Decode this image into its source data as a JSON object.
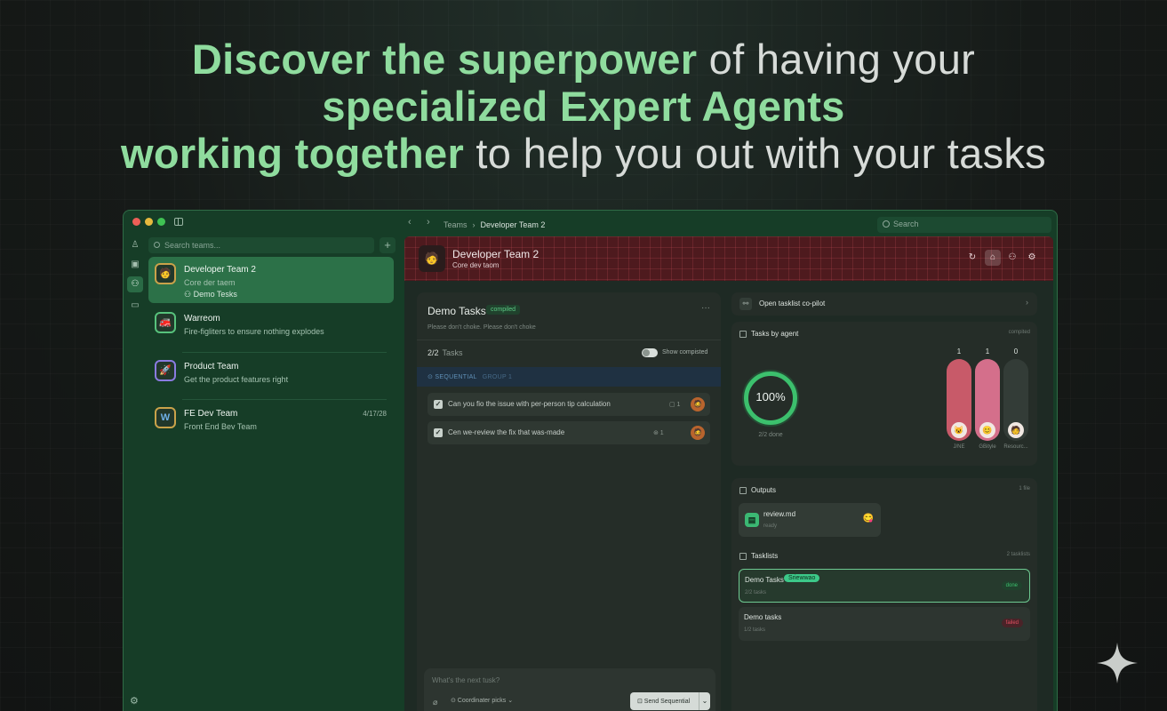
{
  "headline": {
    "line1_highlight": "Discover the superpower",
    "line1_rest": " of having your",
    "line2_highlight": "specialized Expert Agents",
    "line3_highlight": "working together",
    "line3_rest": " to help you out with your tasks"
  },
  "window": {
    "breadcrumb": {
      "root": "Teams",
      "current": "Developer Team 2"
    },
    "search_placeholder": "Search"
  },
  "sidebar": {
    "search_placeholder": "Search teams...",
    "add_label": "+",
    "teams": [
      {
        "name": "Developer Team 2",
        "desc": "Core der taem",
        "sub": "Demo Tesks",
        "date": "",
        "avatar": "🧑",
        "color": "#c9a24a"
      },
      {
        "name": "Warreom",
        "desc": "Fire-figliters to ensure nothing explodes",
        "sub": "",
        "date": "",
        "avatar": "🚒",
        "color": "#57c27c"
      },
      {
        "name": "Product Team",
        "desc": "Get the product features right",
        "sub": "",
        "date": "",
        "avatar": "🚀",
        "color": "#8a7be0"
      },
      {
        "name": "FE Dev Team",
        "desc": "Front End Bev Team",
        "sub": "",
        "date": "4/17/28",
        "avatar": "W",
        "color": "#c9a24a"
      }
    ]
  },
  "banner": {
    "title": "Developer Team 2",
    "subtitle": "Core dev taom",
    "avatar": "🧑"
  },
  "tasks": {
    "title": "Demo Tasks",
    "status": "compiled",
    "description": "Please don't choke. Please don't choke",
    "count": "2/2",
    "count_label": "Tasks",
    "toggle_label": "Show compisted",
    "group_label": "⊙ SEQUENTIAL",
    "group_sub": "GROUP 1",
    "items": [
      {
        "text": "Can you fio the issue with per-person tip calculation",
        "meta": "▢ 1",
        "avatar": "🧔"
      },
      {
        "text": "Cen we-review the fix that was-made",
        "meta": "⊛ 1",
        "avatar": "🧔"
      }
    ],
    "composer_placeholder": "What's the next tusk?",
    "coordinator_label": "⊙ Coordinater picks ⌄",
    "send_label": "⊡ Send Sequential",
    "send_chevron": "⌄"
  },
  "copilot": {
    "label": "Open tasklist co-pilot",
    "icon": "link-icon"
  },
  "agents_card": {
    "title": "Tasks by agent",
    "right_label": "compited",
    "ring_value": "100%",
    "ring_sub": "2/2 done",
    "bars": [
      {
        "count": "1",
        "name": "J/NE",
        "fill": 1.0,
        "color": "#c85a69",
        "avatar": "😺"
      },
      {
        "count": "1",
        "name": "GBityle",
        "fill": 1.0,
        "color": "#d46f8b",
        "avatar": "😊"
      },
      {
        "count": "0",
        "name": "Resourc...",
        "fill": 0.0,
        "color": "#333c37",
        "avatar": "🧑"
      }
    ]
  },
  "outputs": {
    "title": "Outputs",
    "right_label": "1 file",
    "file_name": "review.md",
    "file_sub": "ready",
    "file_icon": "file-icon",
    "file_emoji": "😋"
  },
  "tasklists": {
    "title": "Tasklists",
    "right_label": "2 tasklists",
    "items": [
      {
        "name": "Demo Tasks",
        "badge": "Sriewwao",
        "sub": "2/2 tasks",
        "pill": "done",
        "pill_color": "#3cc06d",
        "pill_bg": "#20422d"
      },
      {
        "name": "Demo tasks",
        "badge": "",
        "sub": "1/2 tasks",
        "pill": "failed",
        "pill_color": "#e05060",
        "pill_bg": "#4a2328"
      }
    ]
  },
  "colors": {
    "accent": "#8fdc9e",
    "window_bg": "#163d27",
    "banner": "#4e1a1e"
  }
}
